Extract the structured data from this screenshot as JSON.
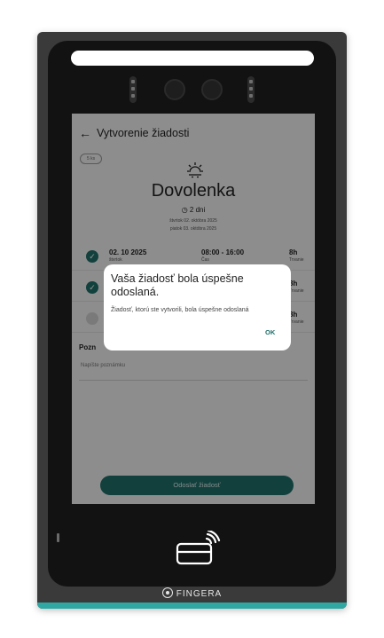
{
  "header": {
    "back_icon": "arrow-left-icon",
    "title": "Vytvorenie žiadosti"
  },
  "chip": "5 ks",
  "request": {
    "icon": "sun-icon",
    "type": "Dovolenka",
    "duration": "2 dni",
    "from": "štvrtok 02. októbra 2025",
    "to": "piatok 03. októbra 2025"
  },
  "rows": [
    {
      "date": "02. 10 2025",
      "day": "štvrtok",
      "time": "08:00 - 16:00",
      "time_sub": "Čas",
      "hours": "8h",
      "hours_sub": "Trvanie",
      "checked": true
    },
    {
      "date": "",
      "day": "",
      "time": "",
      "time_sub": "",
      "hours": "8h",
      "hours_sub": "Trvanie",
      "checked": true
    },
    {
      "date": "",
      "day": "",
      "time": "",
      "time_sub": "",
      "hours": "8h",
      "hours_sub": "Trvanie",
      "checked": false
    }
  ],
  "note": {
    "label": "Pozn",
    "placeholder": "Napíšte poznámku"
  },
  "submit_label": "Odoslať žiadosť",
  "dialog": {
    "title": "Vaša žiadosť bola úspešne odoslaná.",
    "message": "Žiadosť, ktorú ste vytvorili, bola úspešne odoslaná",
    "ok_label": "OK"
  },
  "brand": "FINGERA",
  "colors": {
    "accent": "#1f6f6a",
    "device_strip": "#2fa8a4"
  }
}
